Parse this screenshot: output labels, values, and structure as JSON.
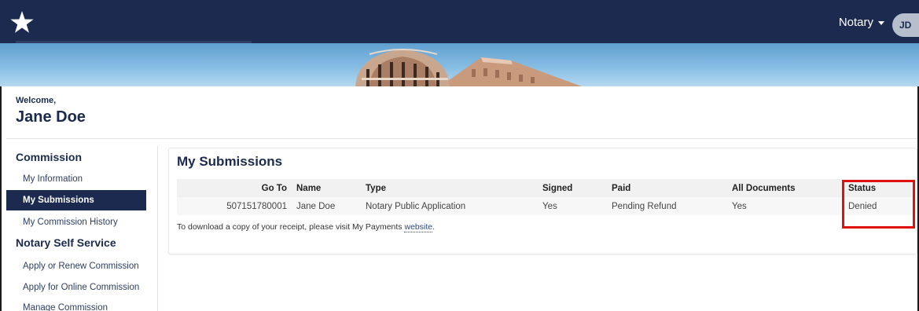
{
  "header": {
    "logo_icon": "star-icon",
    "user_menu_label": "Notary",
    "avatar_initials": "JD"
  },
  "welcome": {
    "label": "Welcome,",
    "name": "Jane Doe"
  },
  "sidebar": {
    "sections": [
      {
        "heading": "Commission",
        "items": [
          {
            "label": "My Information",
            "active": false
          },
          {
            "label": "My Submissions",
            "active": true
          },
          {
            "label": "My Commission History",
            "active": false
          }
        ]
      },
      {
        "heading": "Notary Self Service",
        "items": [
          {
            "label": "Apply or Renew Commission",
            "active": false
          },
          {
            "label": "Apply for Online Commission",
            "active": false
          },
          {
            "label": "Manage Commission",
            "active": false
          }
        ]
      }
    ]
  },
  "submissions": {
    "title": "My Submissions",
    "columns": [
      "Go To",
      "Name",
      "Type",
      "Signed",
      "Paid",
      "All Documents",
      "Status"
    ],
    "rows": [
      {
        "go_to": "507151780001",
        "name": "Jane Doe",
        "type": "Notary Public Application",
        "signed": "Yes",
        "paid": "Pending Refund",
        "all_documents": "Yes",
        "status": "Denied"
      }
    ],
    "receipt_note_prefix": "To download a copy of your receipt, please visit My Payments ",
    "receipt_link": "website",
    "receipt_note_suffix": "."
  },
  "colors": {
    "navy": "#1b2a4e",
    "highlight": "#e01010"
  }
}
